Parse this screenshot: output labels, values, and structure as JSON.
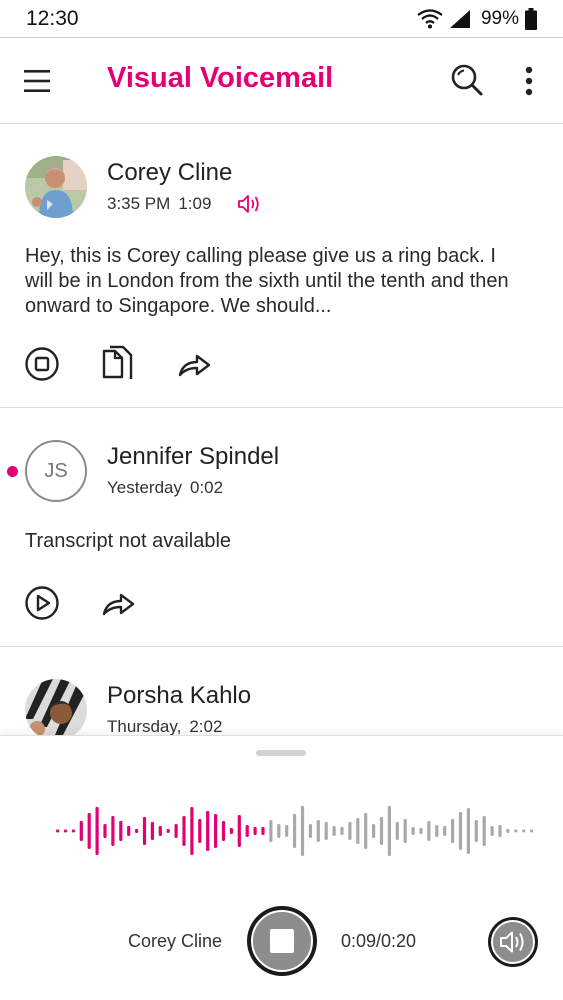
{
  "status_bar": {
    "time": "12:30",
    "battery": "99%"
  },
  "app_bar": {
    "title": "Visual Voicemail"
  },
  "voicemails": [
    {
      "name": "Corey Cline",
      "time": "3:35 PM",
      "duration": "1:09",
      "transcript": "Hey, this is Corey calling please give us a ring back. I will be in London from the sixth until the tenth and then onward to Singapore. We should..."
    },
    {
      "name": "Jennifer Spindel",
      "initials": "JS",
      "time": "Yesterday",
      "duration": "0:02",
      "transcript": "Transcript not available",
      "unread": true
    },
    {
      "name": "Porsha Kahlo",
      "time": "Thursday,",
      "duration": "2:02"
    }
  ],
  "player": {
    "name": "Corey Cline",
    "time": "0:09/0:20",
    "progress": 0.45
  },
  "colors": {
    "accent": "#e20074",
    "wave_inactive": "#a9a9a9"
  }
}
